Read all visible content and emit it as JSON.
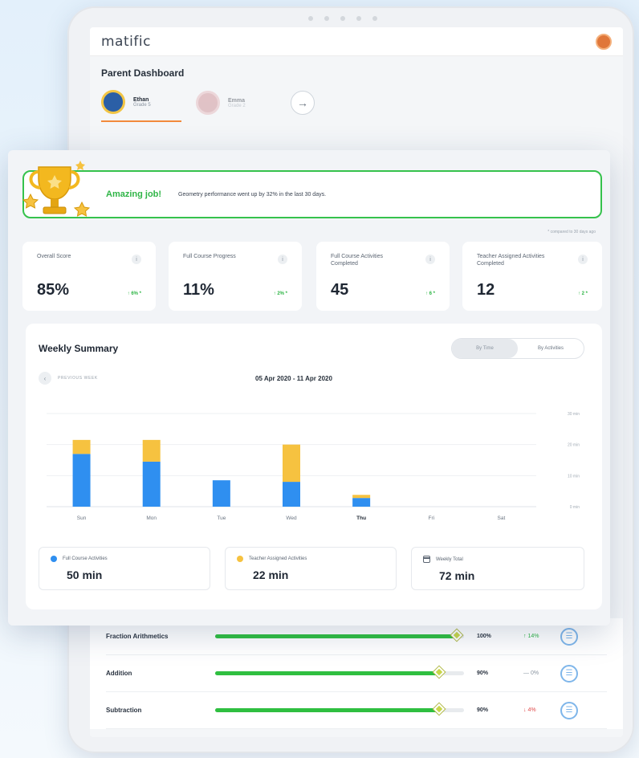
{
  "app": {
    "logo": "matific"
  },
  "dashboard": {
    "title": "Parent Dashboard",
    "kids": [
      {
        "name": "Ethan",
        "grade": "Grade 5",
        "active": true
      },
      {
        "name": "Emma",
        "grade": "Grade 2",
        "active": false
      }
    ]
  },
  "banner": {
    "title": "Amazing job!",
    "message": "Geometry performance went up by 32% in the last 30 days."
  },
  "compare_note": "* compared to 30 days ago",
  "stats": [
    {
      "label": "Overall Score",
      "value": "85%",
      "change": "↑ 6% *"
    },
    {
      "label": "Full Course Progress",
      "value": "11%",
      "change": "↑ 2% *"
    },
    {
      "label": "Full Course Activities Completed",
      "value": "45",
      "change": "↑ 6 *"
    },
    {
      "label": "Teacher Assigned Activities Completed",
      "value": "12",
      "change": "↑ 2 *"
    }
  ],
  "weekly": {
    "title": "Weekly Summary",
    "toggle": [
      "By Time",
      "By Activities"
    ],
    "prev_label": "PREVIOUS WEEK",
    "date_range": "05 Apr 2020 - 11 Apr 2020",
    "summary": [
      {
        "label": "Full Course Activities",
        "value": "50 min"
      },
      {
        "label": "Teacher Assigned Activities",
        "value": "22 min"
      },
      {
        "label": "Weekly Total",
        "value": "72 min"
      }
    ]
  },
  "chart_data": {
    "type": "bar",
    "stacked": true,
    "categories": [
      "Sun",
      "Mon",
      "Tue",
      "Wed",
      "Thu",
      "Fri",
      "Sat"
    ],
    "highlight_category": "Thu",
    "series": [
      {
        "name": "Full Course Activities",
        "color": "#2f8ff0",
        "values": [
          17,
          14.5,
          8.5,
          8,
          2.8,
          0,
          0
        ]
      },
      {
        "name": "Teacher Assigned Activities",
        "color": "#f6c240",
        "values": [
          4.5,
          7,
          0,
          12,
          1,
          0,
          0
        ]
      }
    ],
    "y_ticks": [
      "0 min",
      "10 min",
      "20 min",
      "30 min"
    ],
    "ylim": [
      0,
      30
    ],
    "grid": true
  },
  "topics": [
    {
      "name": "Fraction Arithmetics",
      "progress": 0.97,
      "score": "100%",
      "change": "↑ 14%",
      "change_color": "#2fb546"
    },
    {
      "name": "Addition",
      "progress": 0.9,
      "score": "90%",
      "change": "— 0%",
      "change_color": "#8a94a0"
    },
    {
      "name": "Subtraction",
      "progress": 0.9,
      "score": "90%",
      "change": "↓ 4%",
      "change_color": "#e04b4b"
    }
  ],
  "colors": {
    "accent_green": "#2fb546",
    "bar_blue": "#2f8ff0",
    "bar_yellow": "#f6c240",
    "tab_orange": "#f28a3b"
  }
}
